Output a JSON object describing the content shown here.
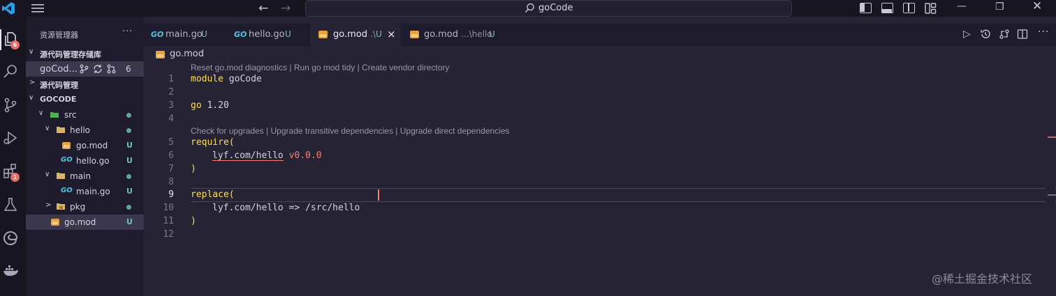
{
  "colors": {
    "accent_keyword": "#fede5d",
    "version": "#f97e72",
    "untracked": "#6fc2b4",
    "badge": "#e86a6a",
    "go_icon": "#4ec6e6"
  },
  "titlebar": {
    "search_text": "goCode"
  },
  "activity": {
    "explorer_badge": "6",
    "extensions_badge": "1"
  },
  "sidebar": {
    "title": "资源管理器",
    "more": "···",
    "section_repos": "源代码管理存储库",
    "repo_name": "goCod...",
    "repo_count": "6",
    "section_scm": "源代码管理",
    "workspace": "GOCODE",
    "tree": [
      {
        "label": "src",
        "status": "dot"
      },
      {
        "label": "hello",
        "status": "dot"
      },
      {
        "label": "go.mod",
        "status": "U"
      },
      {
        "label": "hello.go",
        "status": "U"
      },
      {
        "label": "main",
        "status": "dot"
      },
      {
        "label": "main.go",
        "status": "U"
      },
      {
        "label": "pkg",
        "status": "dot"
      },
      {
        "label": "go.mod",
        "status": "U"
      }
    ]
  },
  "tabs": [
    {
      "label": "main.go",
      "badge": "U"
    },
    {
      "label": "hello.go",
      "badge": "U"
    },
    {
      "label": "go.mod",
      "desc": ".\\",
      "badge": "U"
    },
    {
      "label": "go.mod",
      "desc": "...\\hello",
      "badge": "U"
    }
  ],
  "breadcrumb": "go.mod",
  "editor": {
    "lens_1": "Reset go.mod diagnostics | Run go mod tidy | Create vendor directory",
    "lens_2": "Check for upgrades | Upgrade transitive dependencies | Upgrade direct dependencies",
    "line_numbers": [
      "1",
      "2",
      "3",
      "4",
      "5",
      "6",
      "7",
      "8",
      "9",
      "10",
      "11",
      "12"
    ],
    "l1_kw": "module",
    "l1_rest": " goCode",
    "l3_kw": "go",
    "l3_rest": " 1.20",
    "l5": "require(",
    "l6_mod": "lyf.com/hello",
    "l6_ver": "v0.0.0",
    "l7": ")",
    "l9": "replace(",
    "l10": "lyf.com/hello => /src/hello",
    "l11": ")"
  },
  "watermark": "@稀土掘金技术社区"
}
